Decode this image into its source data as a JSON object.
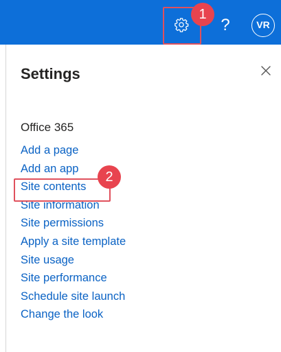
{
  "header": {
    "settings_icon": "gear-icon",
    "help_label": "?",
    "avatar_initials": "VR",
    "bar_color": "#0d6fd9"
  },
  "panel": {
    "title": "Settings",
    "close_icon": "close-icon",
    "section_title": "Office 365",
    "links": [
      {
        "label": "Add a page"
      },
      {
        "label": "Add an app"
      },
      {
        "label": "Site contents"
      },
      {
        "label": "Site information"
      },
      {
        "label": "Site permissions"
      },
      {
        "label": "Apply a site template"
      },
      {
        "label": "Site usage"
      },
      {
        "label": "Site performance"
      },
      {
        "label": "Schedule site launch"
      },
      {
        "label": "Change the look"
      }
    ],
    "link_color": "#0a62c4"
  },
  "annotations": {
    "step1": "1",
    "step2": "2",
    "color": "#e8444f"
  }
}
